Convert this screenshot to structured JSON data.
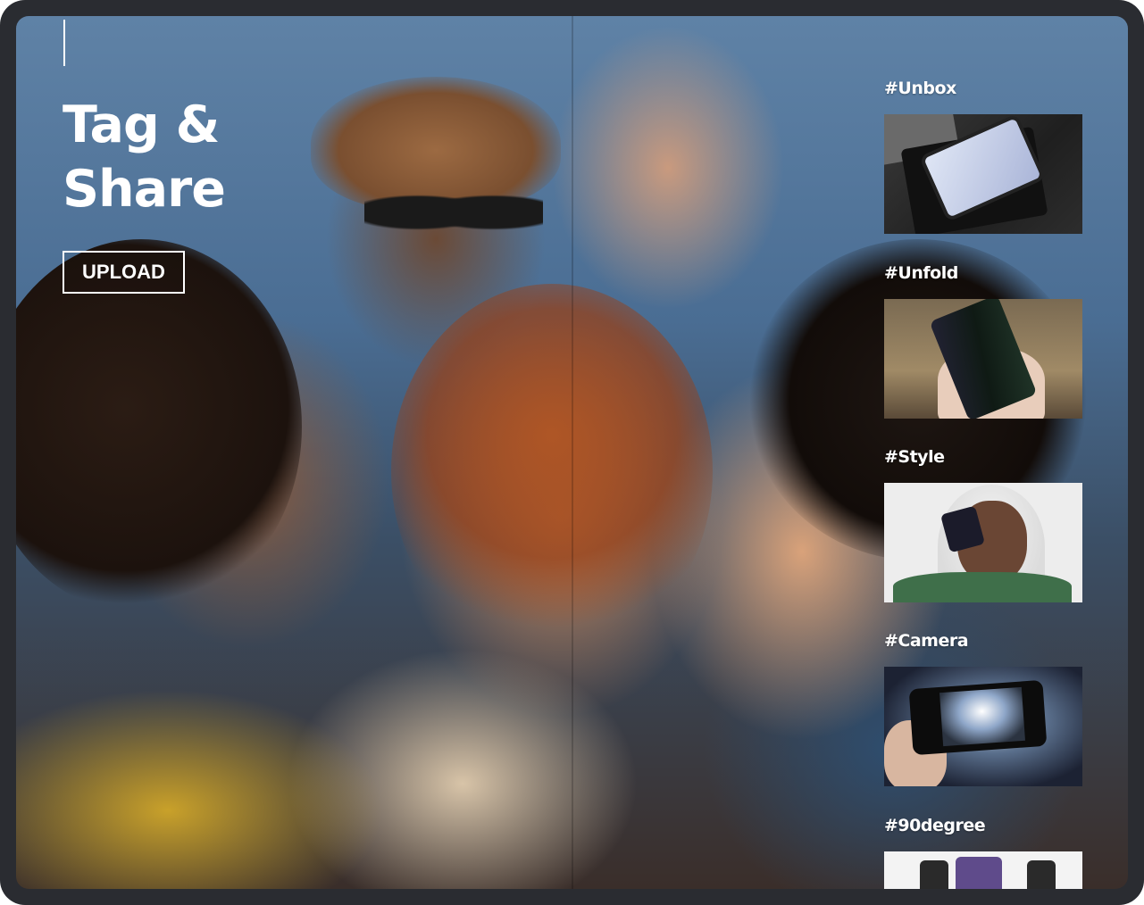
{
  "hero": {
    "headline_line1": "Tag &",
    "headline_line2": "Share",
    "upload_label": "UPLOAD"
  },
  "tags": [
    {
      "label": "#Unbox"
    },
    {
      "label": "#Unfold"
    },
    {
      "label": "#Style"
    },
    {
      "label": "#Camera"
    },
    {
      "label": "#90degree"
    }
  ],
  "colors": {
    "device_frame": "#2a2c31",
    "text": "#ffffff",
    "sky": "#5f82a6"
  }
}
